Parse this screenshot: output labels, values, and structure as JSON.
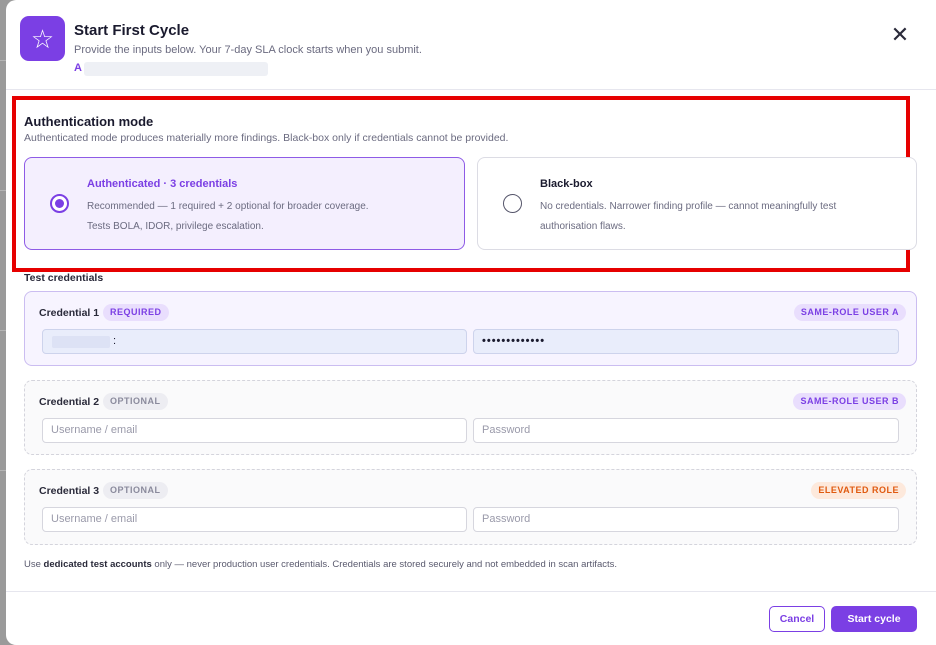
{
  "header": {
    "icon": "star-icon",
    "title": "Start First Cycle",
    "subtitle": "Provide the inputs below. Your 7-day SLA clock starts when you submit.",
    "target_prefix": "A",
    "close_icon": "close-icon"
  },
  "auth": {
    "title": "Authentication mode",
    "subtitle": "Authenticated mode produces materially more findings. Black-box only if credentials cannot be provided.",
    "selected": "authenticated",
    "options": [
      {
        "id": "authenticated",
        "title": "Authenticated · 3 credentials",
        "line1": "Recommended — 1 required + 2 optional for broader coverage.",
        "line2": "Tests BOLA, IDOR, privilege escalation."
      },
      {
        "id": "blackbox",
        "title": "Black-box",
        "line1": "No credentials. Narrower finding profile — cannot meaningfully test",
        "line2": "authorisation flaws."
      }
    ]
  },
  "credentials": {
    "heading": "Test credentials",
    "items": [
      {
        "label": "Credential 1",
        "badge": "REQUIRED",
        "role": "SAME-ROLE USER A",
        "username_value": ":",
        "password_value": "•••••••••••••",
        "username_placeholder": "Username / email",
        "password_placeholder": "Password"
      },
      {
        "label": "Credential 2",
        "badge": "OPTIONAL",
        "role": "SAME-ROLE USER B",
        "username_placeholder": "Username / email",
        "password_placeholder": "Password"
      },
      {
        "label": "Credential 3",
        "badge": "OPTIONAL",
        "role": "ELEVATED ROLE",
        "username_placeholder": "Username / email",
        "password_placeholder": "Password"
      }
    ]
  },
  "note": {
    "prefix": "Use ",
    "bold": "dedicated test accounts",
    "suffix": " only — never production user credentials. Credentials are stored securely and not embedded in scan artifacts."
  },
  "footer": {
    "cancel_label": "Cancel",
    "start_label": "Start cycle"
  },
  "colors": {
    "accent": "#7b3fe4",
    "highlight_border": "#e60000",
    "elevated": "#e05a10"
  }
}
